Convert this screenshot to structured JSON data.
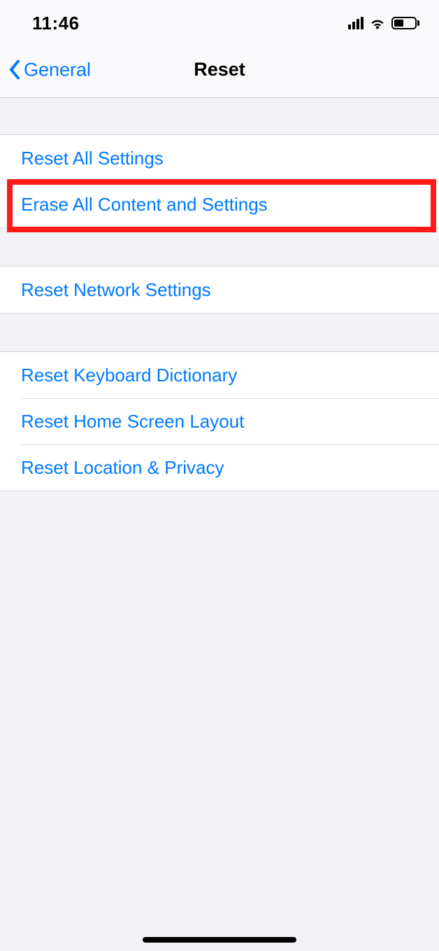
{
  "status": {
    "time": "11:46"
  },
  "nav": {
    "back_label": "General",
    "title": "Reset"
  },
  "sections": [
    {
      "rows": [
        {
          "label": "Reset All Settings"
        },
        {
          "label": "Erase All Content and Settings",
          "highlighted": true
        }
      ]
    },
    {
      "rows": [
        {
          "label": "Reset Network Settings"
        }
      ]
    },
    {
      "rows": [
        {
          "label": "Reset Keyboard Dictionary"
        },
        {
          "label": "Reset Home Screen Layout"
        },
        {
          "label": "Reset Location & Privacy"
        }
      ]
    }
  ]
}
